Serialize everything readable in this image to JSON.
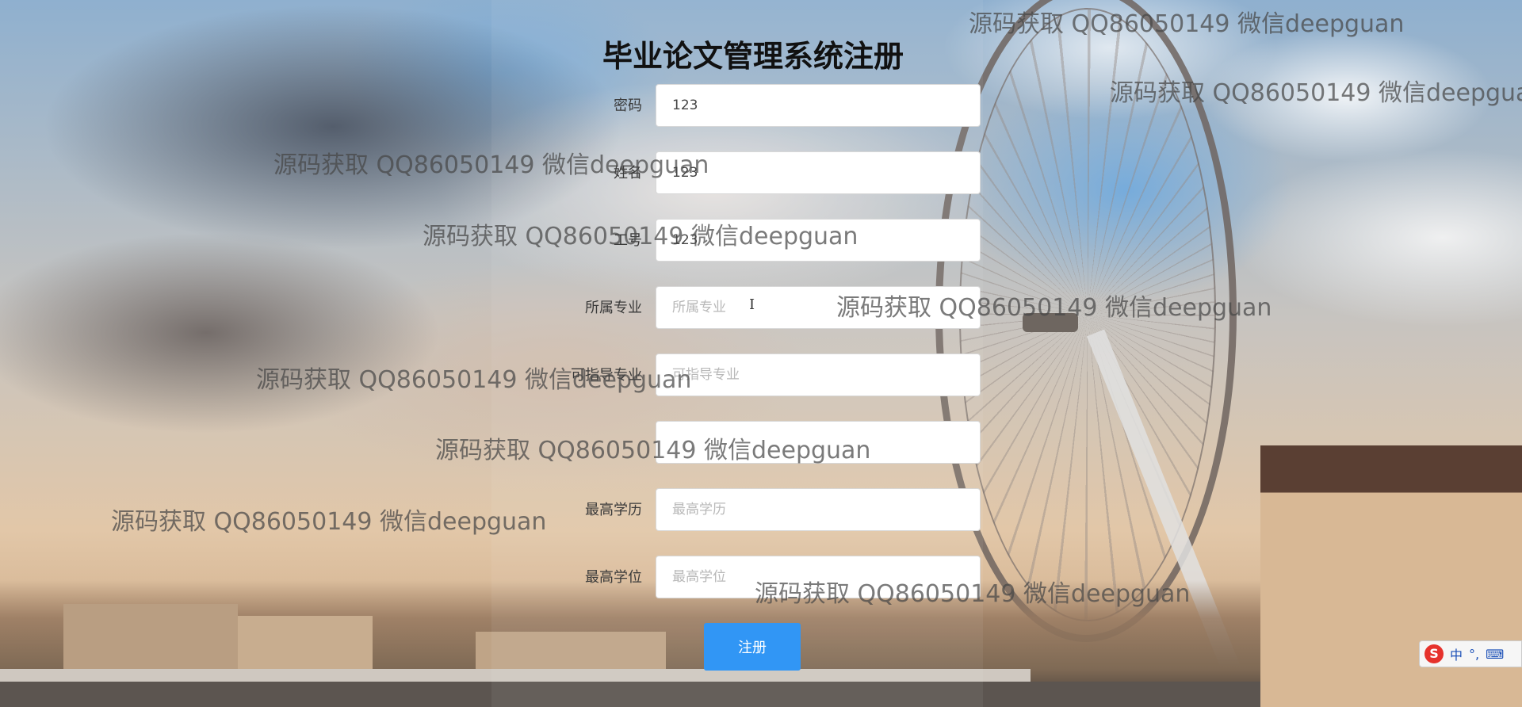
{
  "form": {
    "title": "毕业论文管理系统注册",
    "fields": [
      {
        "label": "密码",
        "value": "123",
        "placeholder": ""
      },
      {
        "label": "姓名",
        "value": "123",
        "placeholder": ""
      },
      {
        "label": "工号",
        "value": "123",
        "placeholder": ""
      },
      {
        "label": "所属专业",
        "value": "",
        "placeholder": "所属专业"
      },
      {
        "label": "可指导专业",
        "value": "",
        "placeholder": "可指导专业"
      },
      {
        "label": "",
        "value": "",
        "placeholder": ""
      },
      {
        "label": "最高学历",
        "value": "",
        "placeholder": "最高学历"
      },
      {
        "label": "最高学位",
        "value": "",
        "placeholder": "最高学位"
      }
    ],
    "submit_label": "注册"
  },
  "watermark": {
    "text": "源码获取 QQ86050149 微信deepguan"
  },
  "ime": {
    "logo": "S",
    "mode": "中",
    "punct": "°,",
    "keyboard_icon": "⌨"
  },
  "colors": {
    "submit_bg": "#3196f5",
    "title": "#111111"
  }
}
